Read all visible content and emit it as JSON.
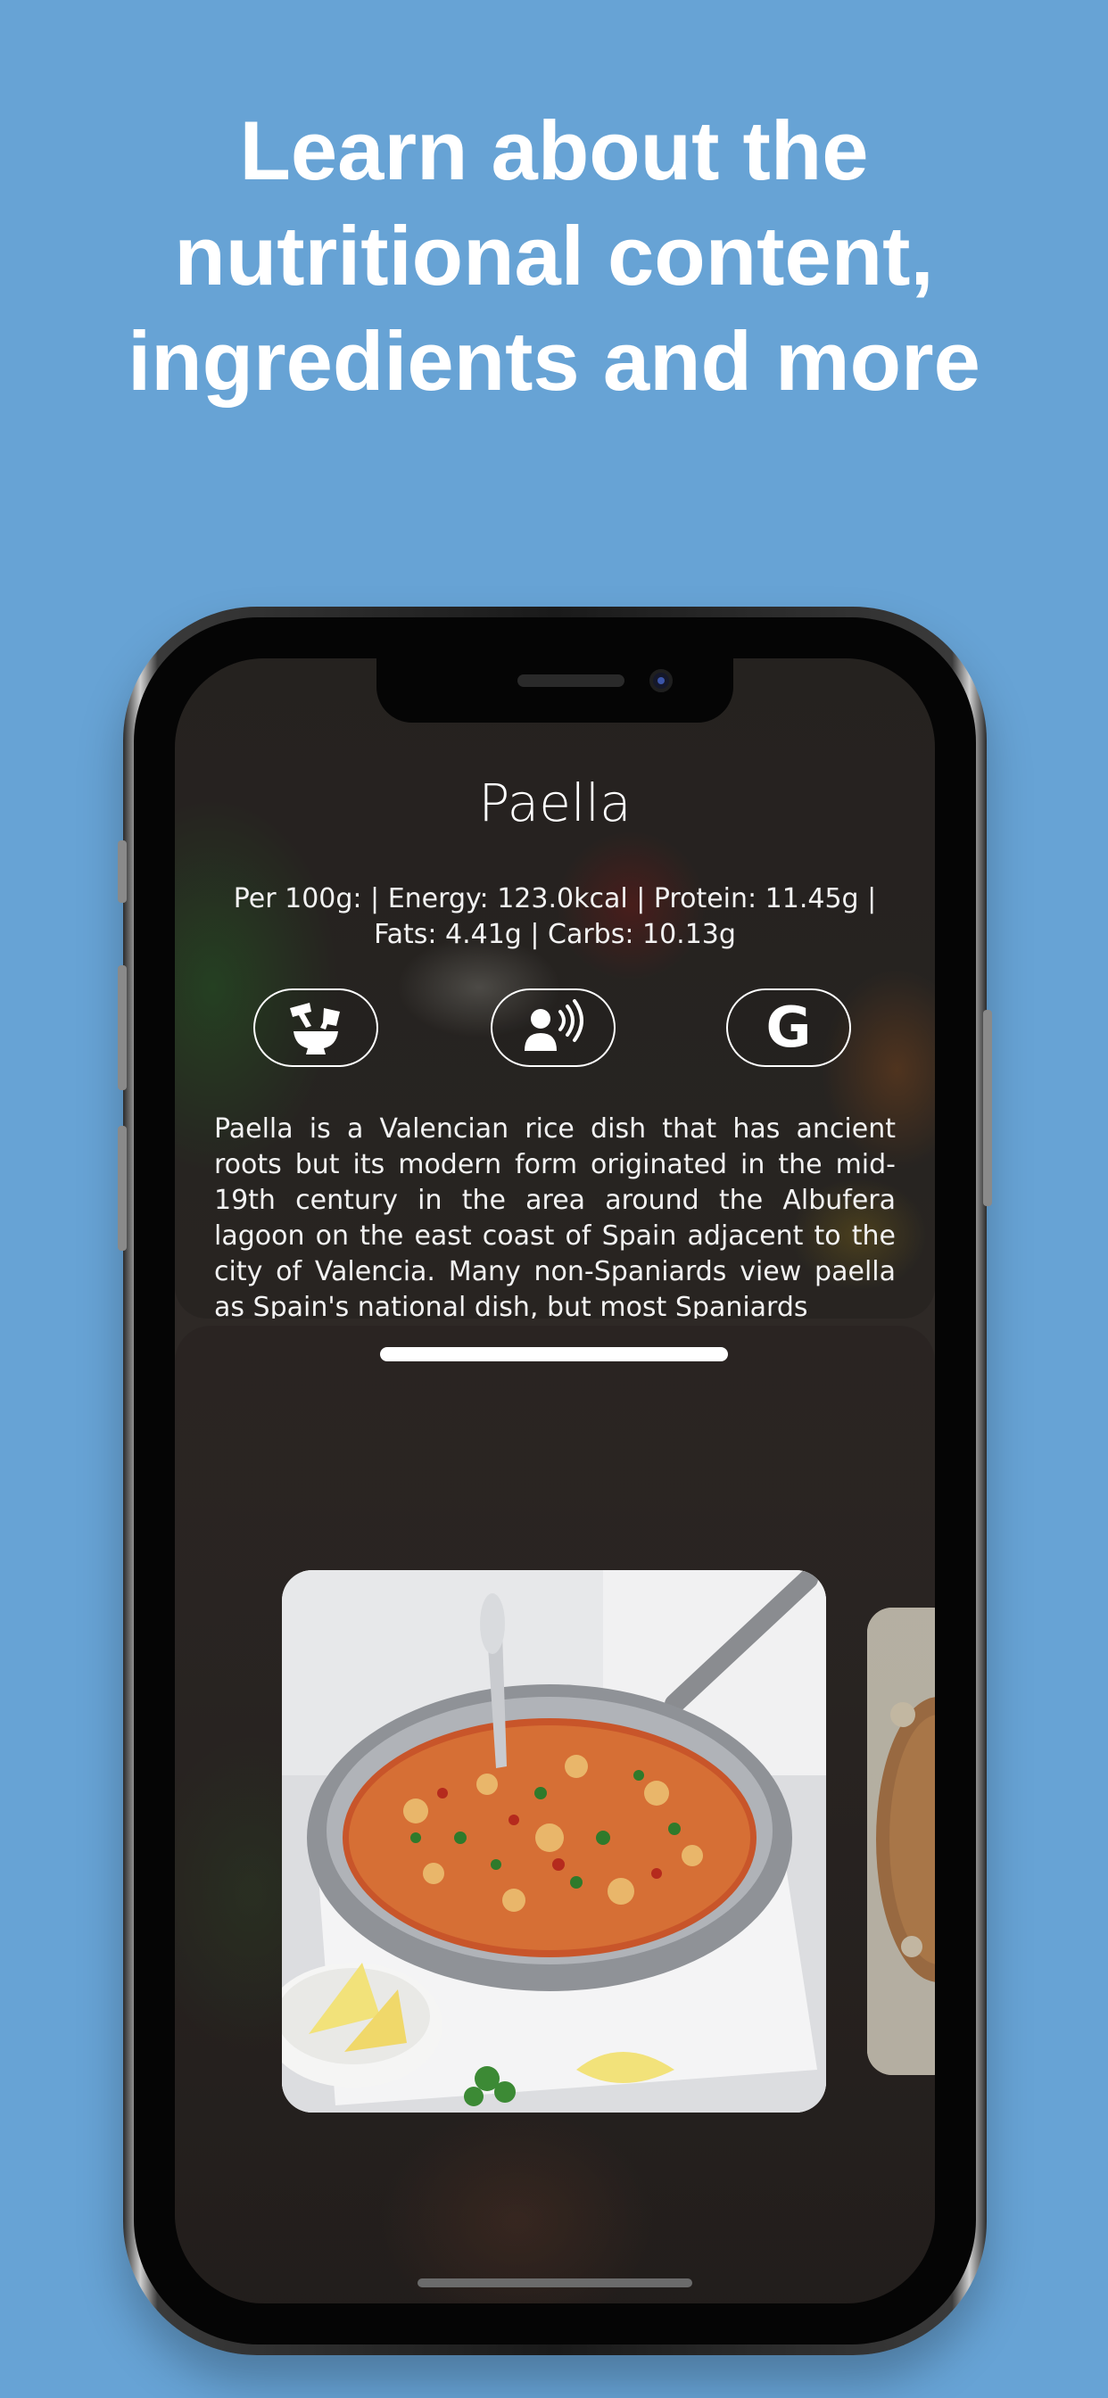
{
  "headline": "Learn about the nutritional content, ingredients and more",
  "dish": {
    "title": "Paella",
    "nutrition": "Per 100g: | Energy: 123.0kcal | Protein: 11.45g | Fats: 4.41g | Carbs: 10.13g",
    "description": "Paella is a Valencian rice dish that has ancient roots but its modern form originated in the mid-19th century in the area around the Albufera lagoon on the east coast of Spain adjacent to the city of Valencia. Many non-Spaniards view paella as Spain's national dish, but most Spaniards"
  },
  "buttons": [
    {
      "icon": "mortar-pestle-icon"
    },
    {
      "icon": "speaker-voice-icon"
    },
    {
      "icon": "google-icon",
      "glyph": "G"
    }
  ],
  "colors": {
    "background": "#67a3d5",
    "text": "#ffffff"
  }
}
